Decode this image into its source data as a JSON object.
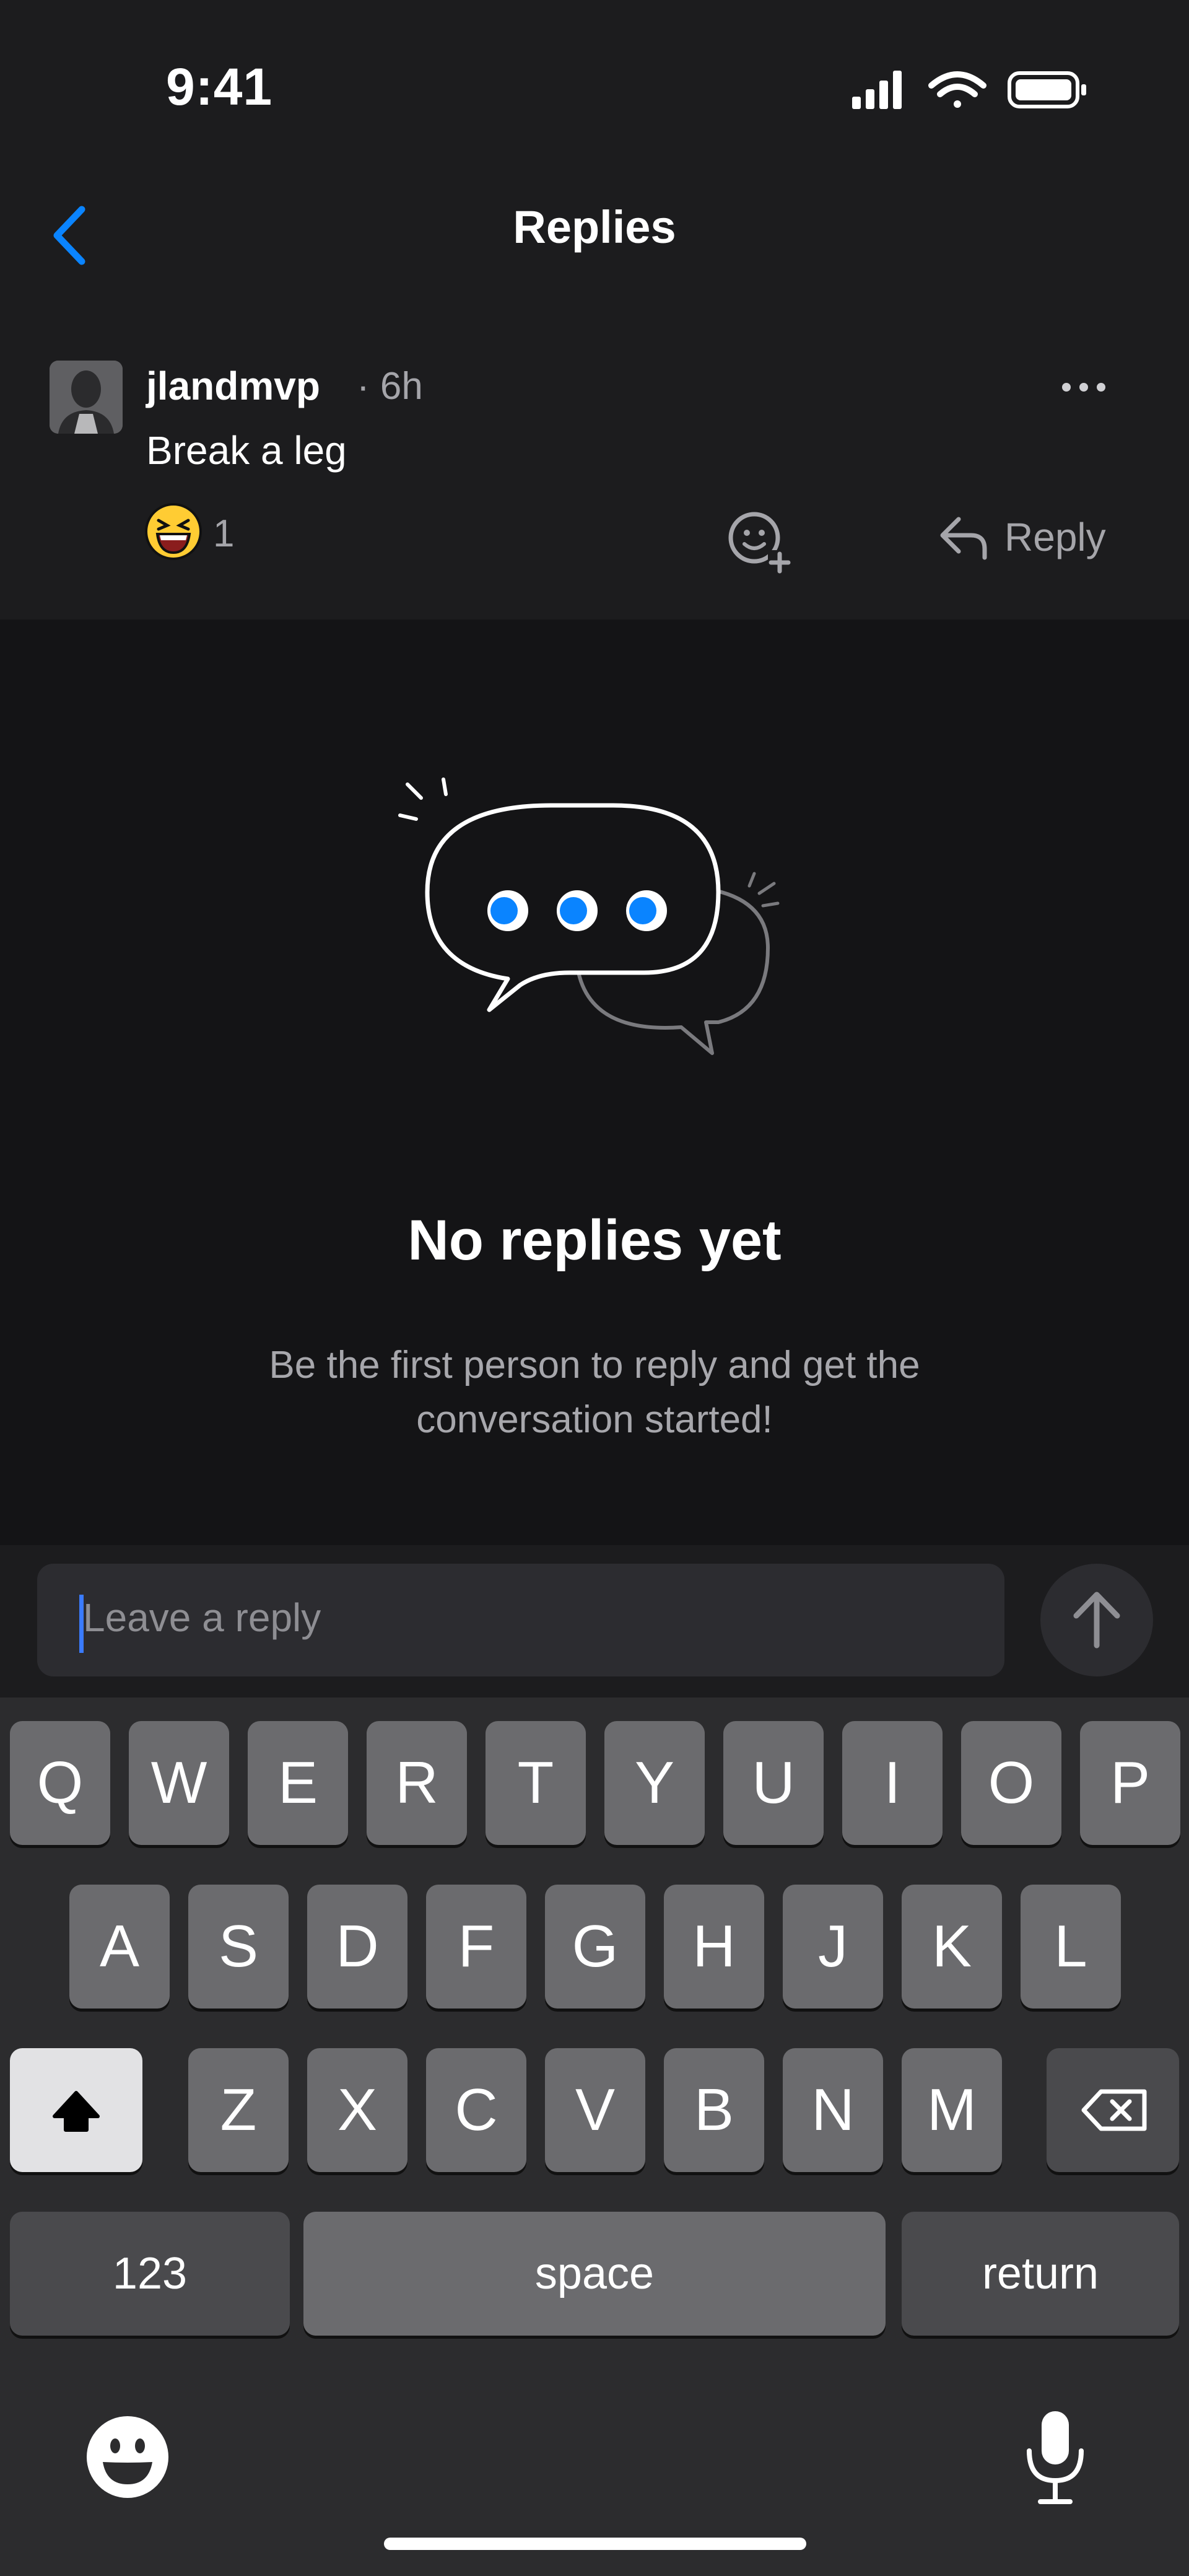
{
  "status_bar": {
    "time": "9:41",
    "signal_icon": "cellular-signal-icon",
    "wifi_icon": "wifi-icon",
    "battery_icon": "battery-icon"
  },
  "nav": {
    "title": "Replies",
    "back_icon": "chevron-left-icon"
  },
  "comment": {
    "username": "jlandmvp",
    "time_ago": "· 6h",
    "text": "Break a leg",
    "reaction_emoji": "laughing-face-emoji",
    "reaction_count": "1",
    "reply_label": "Reply",
    "more_icon": "ellipsis-icon",
    "add_reaction_icon": "add-reaction-icon"
  },
  "empty_state": {
    "title": "No replies yet",
    "subtitle_line1": "Be the first person to reply and get the",
    "subtitle_line2": "conversation started!",
    "illustration": "chat-bubbles-illustration"
  },
  "reply_bar": {
    "placeholder": "Leave a reply",
    "send_icon": "arrow-up-icon"
  },
  "keyboard": {
    "row1": [
      "Q",
      "W",
      "E",
      "R",
      "T",
      "Y",
      "U",
      "I",
      "O",
      "P"
    ],
    "row2": [
      "A",
      "S",
      "D",
      "F",
      "G",
      "H",
      "J",
      "K",
      "L"
    ],
    "row3": [
      "Z",
      "X",
      "C",
      "V",
      "B",
      "N",
      "M"
    ],
    "numbers_label": "123",
    "space_label": "space",
    "return_label": "return",
    "shift_icon": "shift-icon",
    "delete_icon": "delete-icon",
    "emoji_icon": "emoji-icon",
    "mic_icon": "microphone-icon"
  },
  "colors": {
    "accent": "#0a84ff",
    "background": "#1c1c1e",
    "empty_background": "#141416"
  }
}
